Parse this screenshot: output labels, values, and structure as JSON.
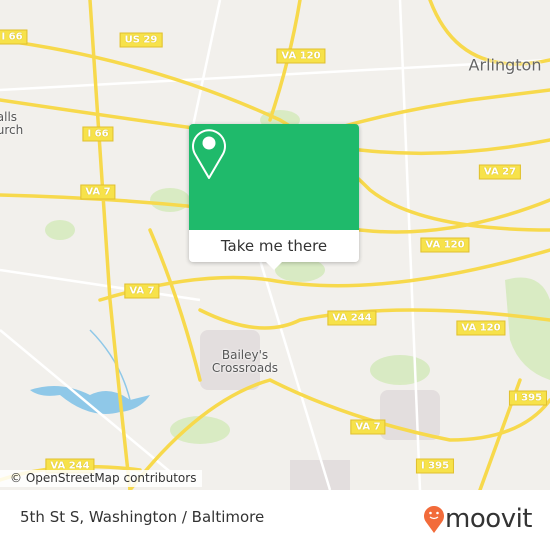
{
  "map": {
    "shields": [
      {
        "label": "I 66"
      },
      {
        "label": "US 29"
      },
      {
        "label": "VA 120"
      },
      {
        "label": "I 66"
      },
      {
        "label": "VA 27"
      },
      {
        "label": "VA 7"
      },
      {
        "label": "VA 120"
      },
      {
        "label": "VA 7"
      },
      {
        "label": "VA 244"
      },
      {
        "label": "VA 120"
      },
      {
        "label": "I 395"
      },
      {
        "label": "VA 7"
      },
      {
        "label": "I 395"
      },
      {
        "label": "VA 244"
      }
    ],
    "places": [
      {
        "label": "Arlington"
      },
      {
        "label": "alls\nurch"
      },
      {
        "label": "Bailey's\nCrossroads"
      }
    ],
    "attribution": "© OpenStreetMap contributors",
    "colors": {
      "road": "#f7d94c",
      "land": "#f2f0ec",
      "park": "#d6eabf",
      "water": "#8fc8e8"
    }
  },
  "popup": {
    "icon": "map-pin-icon",
    "button_label": "Take me there",
    "color": "#1fba6b"
  },
  "footer": {
    "title": "5th St S, Washington / Baltimore",
    "logo_text": "moovit",
    "logo_color": "#f26b3a"
  }
}
